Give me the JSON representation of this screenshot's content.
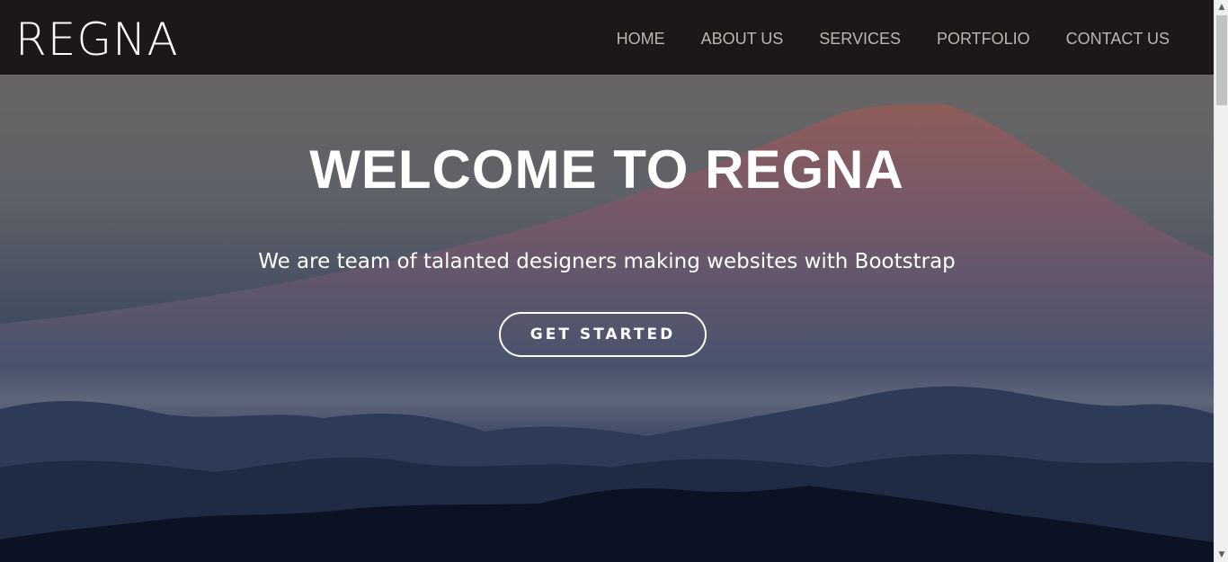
{
  "brand": {
    "logo": "REGNA"
  },
  "nav": {
    "items": [
      {
        "label": "HOME"
      },
      {
        "label": "ABOUT US"
      },
      {
        "label": "SERVICES"
      },
      {
        "label": "PORTFOLIO"
      },
      {
        "label": "CONTACT US"
      }
    ]
  },
  "hero": {
    "title": "WELCOME TO REGNA",
    "subtitle": "We are team of talanted designers making websites with Bootstrap",
    "cta_label": "GET STARTED"
  },
  "colors": {
    "navbar_bg": "#1b1817",
    "nav_text": "#b9b6b3",
    "hero_text": "#ffffff"
  },
  "icons": {
    "scroll_up": "triangle-up",
    "scroll_down": "triangle-down"
  }
}
